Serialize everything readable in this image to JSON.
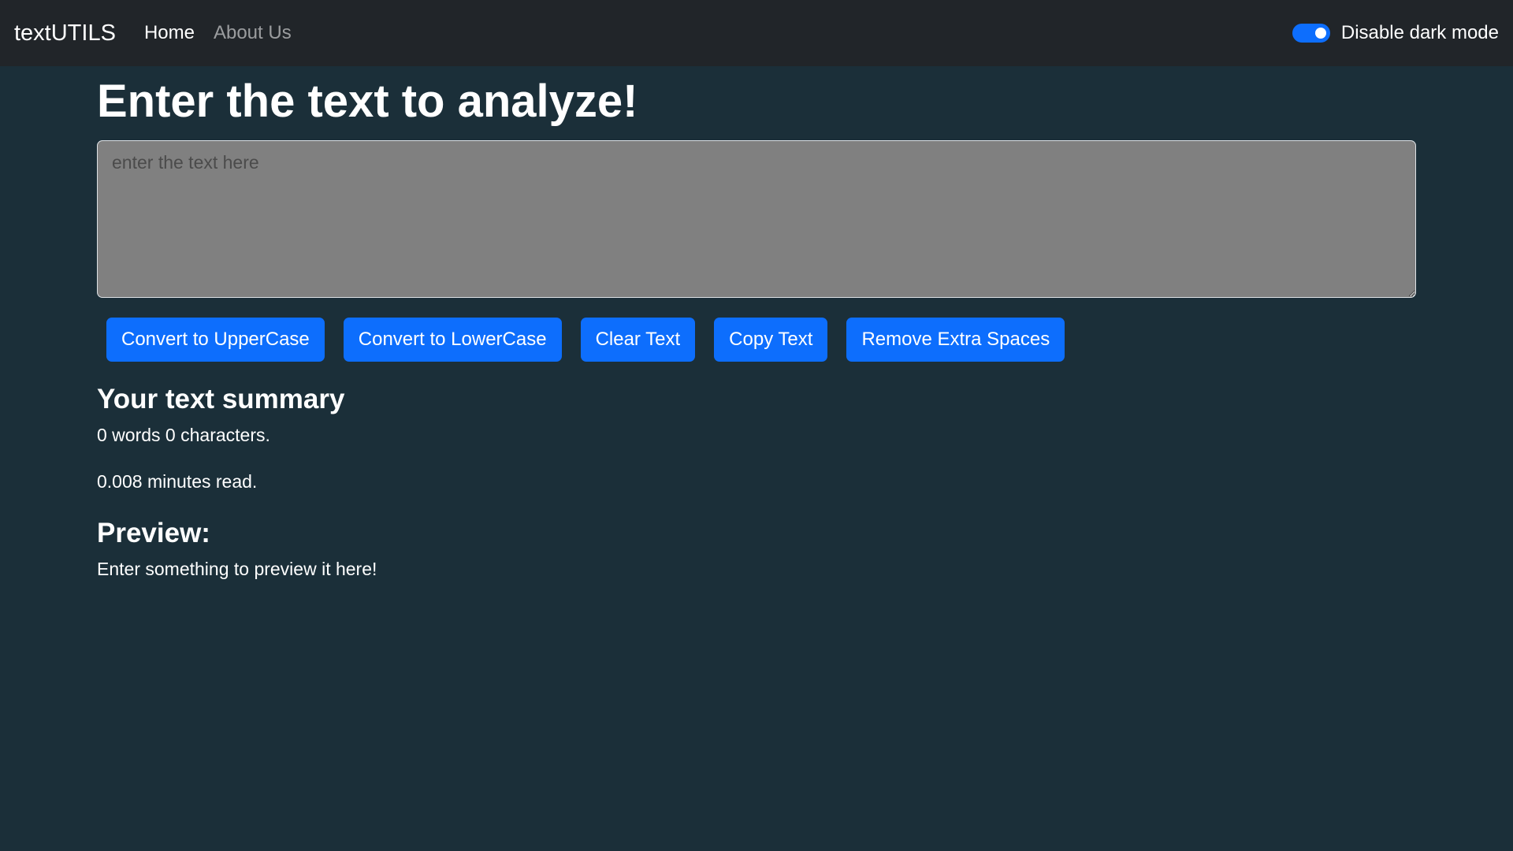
{
  "navbar": {
    "brand": "textUTILS",
    "links": [
      {
        "label": "Home",
        "active": true
      },
      {
        "label": "About Us",
        "active": false
      }
    ],
    "mode_toggle": {
      "label": "Disable dark mode",
      "checked": true
    }
  },
  "main": {
    "title": "Enter the text to analyze!",
    "textarea": {
      "value": "",
      "placeholder": "enter the text here"
    },
    "buttons": [
      "Convert to UpperCase",
      "Convert to LowerCase",
      "Clear Text",
      "Copy Text",
      "Remove Extra Spaces"
    ],
    "summary": {
      "title": "Your text summary",
      "counts": "0 words 0 characters.",
      "read_time": "0.008 minutes read."
    },
    "preview": {
      "title": "Preview:",
      "text": "Enter something to preview it here!"
    }
  },
  "colors": {
    "background": "#1b2f39",
    "navbar": "#212529",
    "accent": "#0d6efd",
    "textarea_bg": "#808080"
  }
}
